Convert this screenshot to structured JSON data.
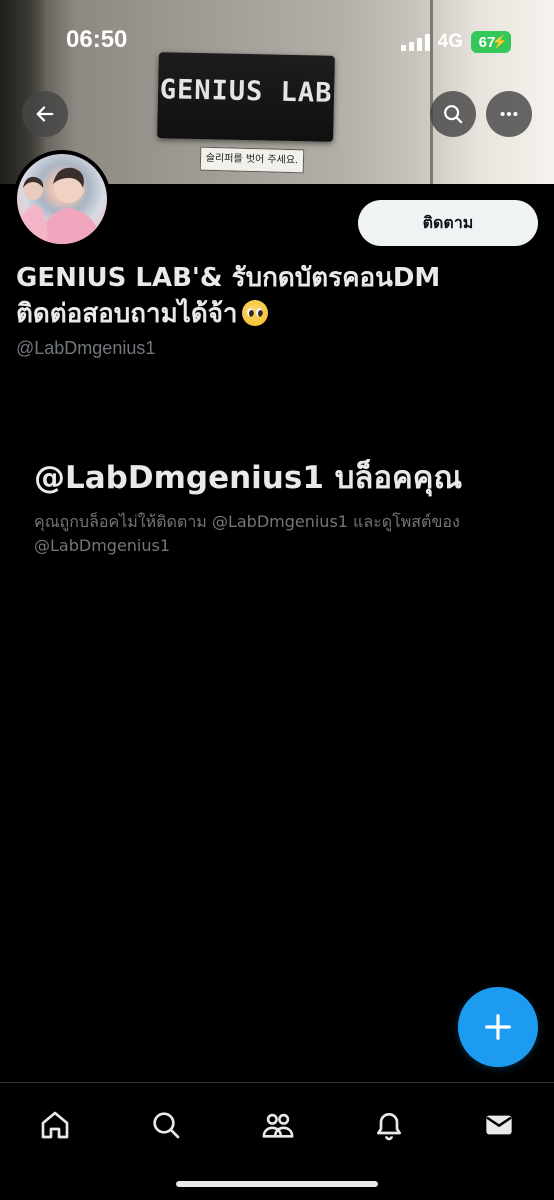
{
  "status_bar": {
    "time": "06:50",
    "network": "4G",
    "battery": "67"
  },
  "banner": {
    "sign_text": "GENIUS LAB",
    "sticker_text": "슬리퍼를 벗어 주세요."
  },
  "header": {
    "back_icon": "arrow-left-icon",
    "search_icon": "search-icon",
    "more_icon": "more-horizontal-icon"
  },
  "profile": {
    "follow_label": "ติดตาม",
    "display_name_line1": "GENIUS LAB'& รับกดบัตรคอนDM",
    "display_name_line2": "ติดต่อสอบถามได้จ้า",
    "handle": "@LabDmgenius1"
  },
  "blocked": {
    "title": "@LabDmgenius1 บล็อคคุณ",
    "description": "คุณถูกบล็อคไม่ให้ติดตาม @LabDmgenius1 และดูโพสต์ของ @LabDmgenius1"
  },
  "bottom_nav": {
    "items": [
      "home-icon",
      "search-icon",
      "communities-icon",
      "notifications-icon",
      "messages-icon"
    ]
  },
  "colors": {
    "accent": "#1d9bf0",
    "background": "#000000",
    "primary_text": "#e7e9ea",
    "secondary_text": "#71767b",
    "battery": "#34c759"
  }
}
